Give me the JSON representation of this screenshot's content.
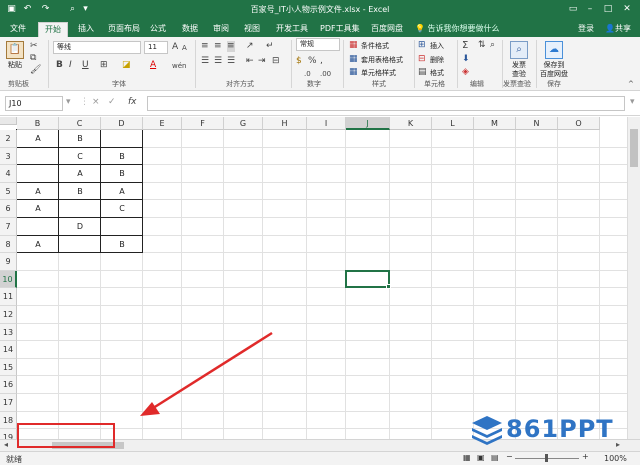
{
  "titlebar": {
    "title": "百家号_IT小人物示例文件.xlsx - Excel",
    "save_icon": "save-icon",
    "undo_icon": "undo-icon",
    "redo_icon": "redo-icon"
  },
  "tabs": [
    "文件",
    "开始",
    "插入",
    "页面布局",
    "公式",
    "数据",
    "审阅",
    "视图",
    "开发工具",
    "PDF工具集",
    "百度网盘"
  ],
  "active_tab": "开始",
  "tell_me": "告诉我你想要做什么",
  "login": "登录",
  "share": "共享",
  "ribbon": {
    "clipboard": {
      "paste": "粘贴",
      "label": "剪贴板"
    },
    "font": {
      "name": "等线",
      "size": "11",
      "bold": "B",
      "italic": "I",
      "underline": "U",
      "grow": "A",
      "shrink": "A",
      "font_color": "A",
      "phonetic": "wén",
      "label": "字体"
    },
    "alignment": {
      "label": "对齐方式"
    },
    "number": {
      "format": "常规",
      "percent": "%",
      "comma": ",",
      "currency": "$",
      "label": "数字"
    },
    "styles": {
      "conditional": "条件格式",
      "table": "套用表格格式",
      "cell": "单元格样式",
      "label": "样式"
    },
    "cells": {
      "insert": "插入",
      "delete": "删除",
      "format": "格式",
      "label": "单元格"
    },
    "editing": {
      "sum": "Σ",
      "label": "编辑"
    },
    "invoice": {
      "btn1": "发票",
      "btn2": "查验",
      "label": "发票查验"
    },
    "save": {
      "btn1": "保存到",
      "btn2": "百度网盘",
      "label": "保存"
    }
  },
  "formula_bar": {
    "name_box": "J10",
    "fx": "fx",
    "cancel": "×",
    "enter": "✓",
    "value": ""
  },
  "columns": [
    "B",
    "C",
    "D",
    "E",
    "F",
    "G",
    "H",
    "I",
    "J",
    "K",
    "L",
    "M",
    "N",
    "O"
  ],
  "selected_column": "J",
  "rows": [
    "2",
    "3",
    "4",
    "5",
    "6",
    "7",
    "8",
    "9",
    "10",
    "11",
    "12",
    "13",
    "14",
    "15",
    "16",
    "17",
    "18",
    "19"
  ],
  "selected_row": "10",
  "cells": [
    {
      "row": "2",
      "col": "B",
      "value": "A"
    },
    {
      "row": "2",
      "col": "C",
      "value": "B"
    },
    {
      "row": "3",
      "col": "C",
      "value": "C"
    },
    {
      "row": "3",
      "col": "D",
      "value": "B"
    },
    {
      "row": "4",
      "col": "C",
      "value": "A"
    },
    {
      "row": "4",
      "col": "D",
      "value": "B"
    },
    {
      "row": "5",
      "col": "B",
      "value": "A"
    },
    {
      "row": "5",
      "col": "C",
      "value": "B"
    },
    {
      "row": "5",
      "col": "D",
      "value": "A"
    },
    {
      "row": "6",
      "col": "B",
      "value": "A"
    },
    {
      "row": "6",
      "col": "D",
      "value": "C"
    },
    {
      "row": "7",
      "col": "C",
      "value": "D"
    },
    {
      "row": "8",
      "col": "B",
      "value": "A"
    },
    {
      "row": "8",
      "col": "D",
      "value": "B"
    }
  ],
  "status": {
    "ready": "就绪",
    "zoom": "100%"
  },
  "watermark": {
    "text": "861PPT"
  },
  "colors": {
    "excel_green": "#217346",
    "annotation_red": "#e02a2a",
    "watermark_blue": "#2f74c4"
  }
}
